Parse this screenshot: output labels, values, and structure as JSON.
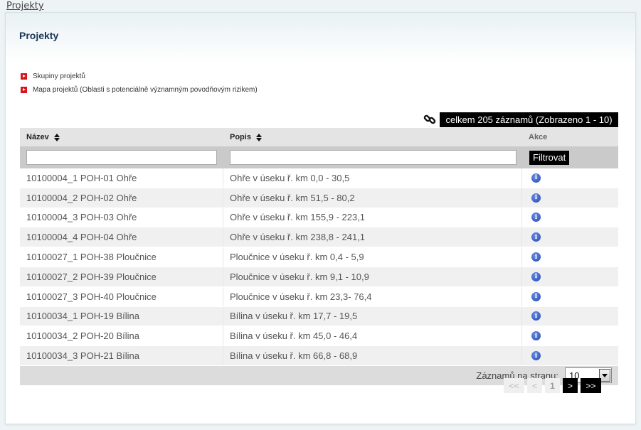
{
  "breadcrumb": "Projekty",
  "page_title": "Projekty",
  "links": [
    {
      "label": "Skupiny projektů"
    },
    {
      "label": "Mapa projektů (Oblasti s potenciálně významným povodňovým rizikem)"
    }
  ],
  "icons": {
    "link": "link-chain-icon",
    "info": "info-icon",
    "arrow": "red-arrow-icon"
  },
  "total_badge": "celkem 205 záznamů (Zobrazeno 1 - 10)",
  "table": {
    "headers": {
      "name": "Název",
      "description": "Popis",
      "actions": "Akce"
    },
    "filter": {
      "name_value": "",
      "description_value": "",
      "button_label": "Filtrovat"
    },
    "rows": [
      {
        "name": "10100004_1 POH-01 Ohře",
        "description": "Ohře v úseku ř. km 0,0 - 30,5"
      },
      {
        "name": "10100004_2 POH-02 Ohře",
        "description": "Ohře v úseku ř. km 51,5 - 80,2"
      },
      {
        "name": "10100004_3 POH-03 Ohře",
        "description": "Ohře v úseku ř. km 155,9 - 223,1"
      },
      {
        "name": "10100004_4 POH-04 Ohře",
        "description": "Ohře v úseku ř. km 238,8 - 241,1"
      },
      {
        "name": "10100027_1 POH-38 Ploučnice",
        "description": "Ploučnice v úseku ř. km 0,4 - 5,9"
      },
      {
        "name": "10100027_2 POH-39 Ploučnice",
        "description": "Ploučnice v úseku ř. km 9,1 - 10,9"
      },
      {
        "name": "10100027_3 POH-40 Ploučnice",
        "description": "Ploučnice v úseku ř. km 23,3- 76,4"
      },
      {
        "name": "10100034_1 POH-19 Bílina",
        "description": "Bílina v úseku ř. km 17,7 - 19,5"
      },
      {
        "name": "10100034_2 POH-20 Bílina",
        "description": "Bílina v úseku ř. km 45,0 - 46,4"
      },
      {
        "name": "10100034_3 POH-21 Bílina",
        "description": "Bílina v úseku ř. km 66,8 - 68,9"
      }
    ],
    "per_page_label": "Záznamů na stranu:",
    "per_page_value": "10"
  },
  "pager": {
    "first": "<<",
    "prev": "<",
    "current": "1",
    "next": ">",
    "last": ">>"
  }
}
